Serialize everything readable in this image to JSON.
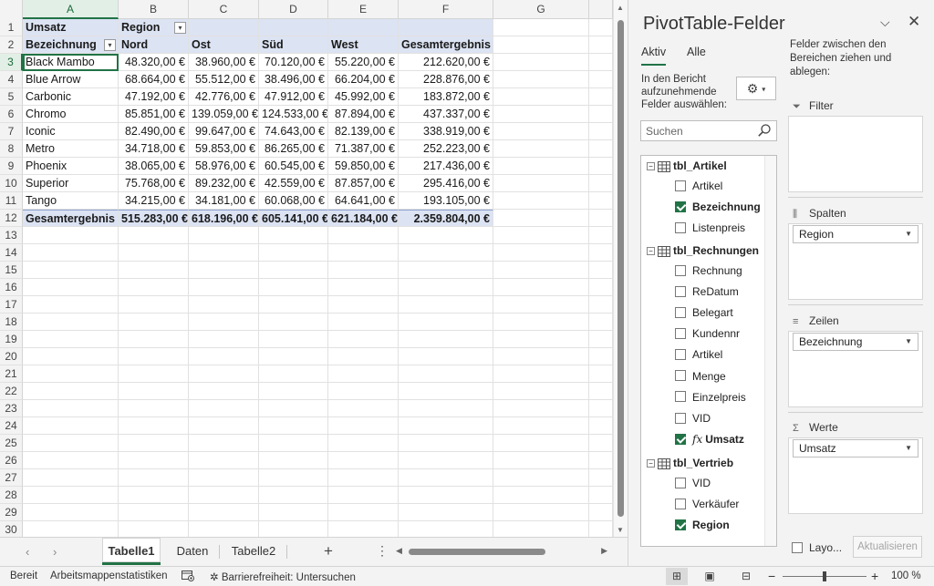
{
  "columns": [
    "A",
    "B",
    "C",
    "D",
    "E",
    "F",
    "G"
  ],
  "active_column": "A",
  "active_row": "3",
  "pivot_table": {
    "title_row": {
      "value_field": "Umsatz",
      "column_field": "Region"
    },
    "header_row": [
      "Bezeichnung",
      "Nord",
      "Ost",
      "Süd",
      "West",
      "Gesamtergebnis"
    ],
    "rows": [
      [
        "Black Mambo",
        "48.320,00 €",
        "38.960,00 €",
        "70.120,00 €",
        "55.220,00 €",
        "212.620,00 €"
      ],
      [
        "Blue Arrow",
        "68.664,00 €",
        "55.512,00 €",
        "38.496,00 €",
        "66.204,00 €",
        "228.876,00 €"
      ],
      [
        "Carbonic",
        "47.192,00 €",
        "42.776,00 €",
        "47.912,00 €",
        "45.992,00 €",
        "183.872,00 €"
      ],
      [
        "Chromo",
        "85.851,00 €",
        "139.059,00 €",
        "124.533,00 €",
        "87.894,00 €",
        "437.337,00 €"
      ],
      [
        "Iconic",
        "82.490,00 €",
        "99.647,00 €",
        "74.643,00 €",
        "82.139,00 €",
        "338.919,00 €"
      ],
      [
        "Metro",
        "34.718,00 €",
        "59.853,00 €",
        "86.265,00 €",
        "71.387,00 €",
        "252.223,00 €"
      ],
      [
        "Phoenix",
        "38.065,00 €",
        "58.976,00 €",
        "60.545,00 €",
        "59.850,00 €",
        "217.436,00 €"
      ],
      [
        "Superior",
        "75.768,00 €",
        "89.232,00 €",
        "42.559,00 €",
        "87.857,00 €",
        "295.416,00 €"
      ],
      [
        "Tango",
        "34.215,00 €",
        "34.181,00 €",
        "60.068,00 €",
        "64.641,00 €",
        "193.105,00 €"
      ]
    ],
    "total_row": [
      "Gesamtergebnis",
      "515.283,00 €",
      "618.196,00 €",
      "605.141,00 €",
      "621.184,00 €",
      "2.359.804,00 €"
    ]
  },
  "row_numbers": [
    "1",
    "2",
    "3",
    "4",
    "5",
    "6",
    "7",
    "8",
    "9",
    "10",
    "11",
    "12",
    "13",
    "14",
    "15",
    "16",
    "17",
    "18",
    "19",
    "20",
    "21",
    "22",
    "23",
    "24",
    "25",
    "26",
    "27",
    "28",
    "29",
    "30"
  ],
  "sheet_tabs": [
    {
      "label": "Tabelle1",
      "active": true
    },
    {
      "label": "Daten",
      "active": false
    },
    {
      "label": "Tabelle2",
      "active": false
    }
  ],
  "pivot_pane": {
    "title": "PivotTable-Felder",
    "tabs": [
      "Aktiv",
      "Alle"
    ],
    "choose_fields_label": "In den Bericht aufzunehmende Felder auswählen:",
    "search_placeholder": "Suchen",
    "areas_label": "Felder zwischen den Bereichen ziehen und ablegen:",
    "tables": [
      {
        "name": "tbl_Artikel",
        "fields": [
          {
            "label": "Artikel",
            "checked": false
          },
          {
            "label": "Bezeichnung",
            "checked": true
          },
          {
            "label": "Listenpreis",
            "checked": false
          }
        ]
      },
      {
        "name": "tbl_Rechnungen",
        "fields": [
          {
            "label": "Rechnung",
            "checked": false
          },
          {
            "label": "ReDatum",
            "checked": false
          },
          {
            "label": "Belegart",
            "checked": false
          },
          {
            "label": "Kundennr",
            "checked": false
          },
          {
            "label": "Artikel",
            "checked": false
          },
          {
            "label": "Menge",
            "checked": false
          },
          {
            "label": "Einzelpreis",
            "checked": false
          },
          {
            "label": "VID",
            "checked": false
          },
          {
            "label": "Umsatz",
            "checked": true,
            "calculated": true
          }
        ]
      },
      {
        "name": "tbl_Vertrieb",
        "fields": [
          {
            "label": "VID",
            "checked": false
          },
          {
            "label": "Verkäufer",
            "checked": false
          },
          {
            "label": "Region",
            "checked": true
          }
        ]
      }
    ],
    "areas": {
      "filter": {
        "title": "Filter",
        "items": []
      },
      "columns": {
        "title": "Spalten",
        "items": [
          "Region"
        ]
      },
      "rows": {
        "title": "Zeilen",
        "items": [
          "Bezeichnung"
        ]
      },
      "values": {
        "title": "Werte",
        "items": [
          "Umsatz"
        ]
      }
    },
    "defer_label": "Layo...",
    "update_label": "Aktualisieren"
  },
  "status_bar": {
    "ready": "Bereit",
    "workbook_stats": "Arbeitsmappenstatistiken",
    "accessibility": "Barrierefreiheit: Untersuchen",
    "zoom_minus": "−",
    "zoom_plus": "+",
    "zoom": "100 %"
  }
}
